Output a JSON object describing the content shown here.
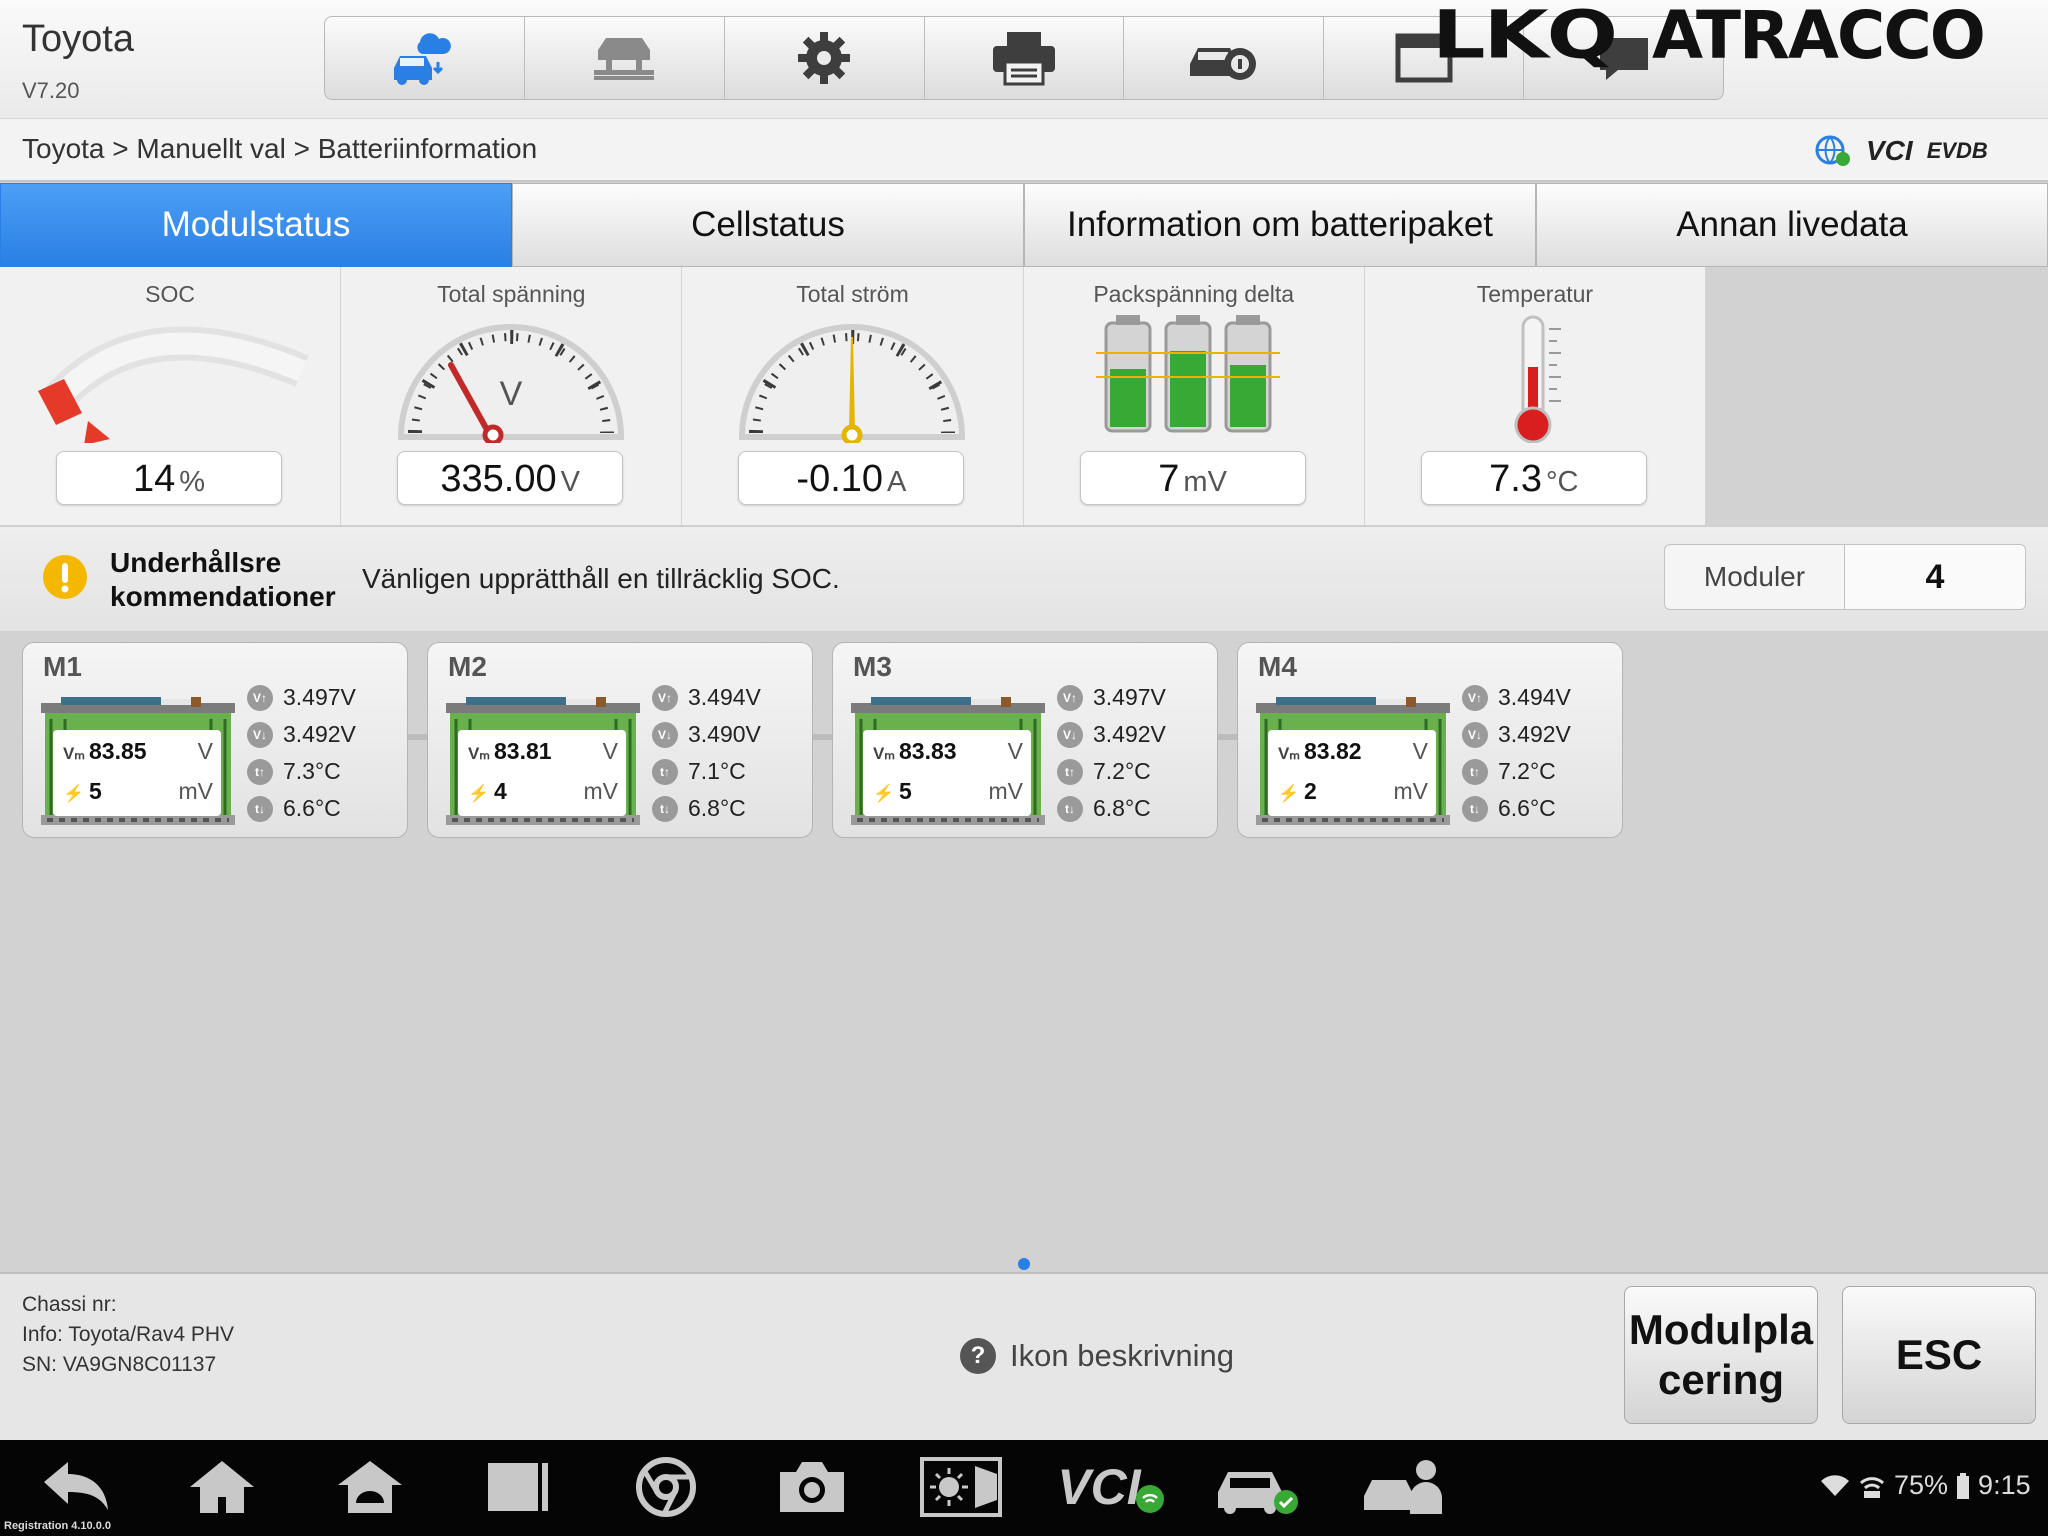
{
  "app": {
    "title": "Toyota",
    "version": "V7.20"
  },
  "toolbar": {
    "items": [
      {
        "icon": "car-cloud-icon",
        "active": true
      },
      {
        "icon": "car-lift-icon"
      },
      {
        "icon": "gear-icon"
      },
      {
        "icon": "printer-icon"
      },
      {
        "icon": "car-info-icon"
      },
      {
        "icon": "window-icon"
      },
      {
        "icon": "chat-icon"
      }
    ]
  },
  "watermark": {
    "lkq": "LKQ",
    "atracco": "ATRACCO"
  },
  "breadcrumb": "Toyota > Manuellt val > Batteriinformation",
  "status_icons": {
    "vci": "VCI",
    "evdb": "EVDB"
  },
  "tabs": [
    {
      "label": "Modulstatus",
      "active": true
    },
    {
      "label": "Cellstatus"
    },
    {
      "label": "Information om batteripaket"
    },
    {
      "label": "Annan livedata"
    }
  ],
  "gauges": [
    {
      "label": "SOC",
      "value": "14",
      "unit": "%",
      "icon": "soc-gauge-icon"
    },
    {
      "label": "Total spänning",
      "value": "335.00",
      "unit": "V",
      "icon": "voltmeter-icon",
      "dial": "V"
    },
    {
      "label": "Total ström",
      "value": "-0.10",
      "unit": "A",
      "icon": "ammeter-icon"
    },
    {
      "label": "Packspänning delta",
      "value": "7",
      "unit": "mV",
      "icon": "battery-cells-icon"
    },
    {
      "label": "Temperatur",
      "value": "7.3",
      "unit": "°C",
      "icon": "thermometer-icon"
    }
  ],
  "advice": {
    "title_line1": "Underhållsre",
    "title_line2": "kommendationer",
    "text": "Vänligen upprätthåll en tillräcklig SOC."
  },
  "modules_count": {
    "label": "Moduler",
    "value": "4"
  },
  "modules": [
    {
      "name": "M1",
      "voltage": "83.85",
      "voltage_unit": "V",
      "delta": "5",
      "delta_unit": "mV",
      "vmax": "3.497V",
      "vmin": "3.492V",
      "tmax": "7.3°C",
      "tmin": "6.6°C"
    },
    {
      "name": "M2",
      "voltage": "83.81",
      "voltage_unit": "V",
      "delta": "4",
      "delta_unit": "mV",
      "vmax": "3.494V",
      "vmin": "3.490V",
      "tmax": "7.1°C",
      "tmin": "6.8°C"
    },
    {
      "name": "M3",
      "voltage": "83.83",
      "voltage_unit": "V",
      "delta": "5",
      "delta_unit": "mV",
      "vmax": "3.497V",
      "vmin": "3.492V",
      "tmax": "7.2°C",
      "tmin": "6.8°C"
    },
    {
      "name": "M4",
      "voltage": "83.82",
      "voltage_unit": "V",
      "delta": "2",
      "delta_unit": "mV",
      "vmax": "3.494V",
      "vmin": "3.492V",
      "tmax": "7.2°C",
      "tmin": "6.6°C"
    }
  ],
  "footer": {
    "chassis": "Chassi nr:",
    "info": "Info: Toyota/Rav4 PHV",
    "sn": "SN: VA9GN8C01137",
    "icon_desc": "Ikon beskrivning",
    "btn_placement_1": "Modulpla",
    "btn_placement_2": "cering",
    "btn_esc": "ESC"
  },
  "navbar": {
    "items": [
      "back-icon",
      "home-icon",
      "android-icon",
      "recent-apps-icon",
      "browser-icon",
      "camera-icon",
      "brightness-icon",
      "vci-icon",
      "car-check-icon",
      "support-icon"
    ],
    "vci_label": "VCI",
    "registration": "Registration 4.10.0.0",
    "battery": "75%",
    "time": "9:15"
  },
  "colors": {
    "accent": "#2a7fe4",
    "warning": "#f5b800",
    "battery_green": "#39a935",
    "temp_red": "#d81e1e",
    "needle_red": "#c22a2a",
    "needle_yellow": "#e3b400"
  }
}
